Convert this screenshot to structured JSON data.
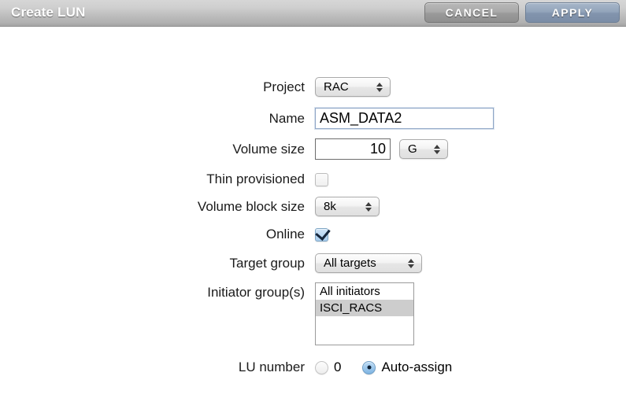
{
  "window": {
    "title": "Create LUN"
  },
  "titlebar": {
    "cancel_label": "CANCEL",
    "apply_label": "APPLY",
    "cancel_color": "#9a9a9a",
    "apply_color": "#8294ad",
    "title_color": "#ffffff"
  },
  "form": {
    "project": {
      "label": "Project",
      "value": "RAC"
    },
    "name": {
      "label": "Name",
      "value": "ASM_DATA2",
      "placeholder": "",
      "focused": true
    },
    "volume_size": {
      "label": "Volume size",
      "value": "10",
      "unit": "G"
    },
    "thin_provisioned": {
      "label": "Thin provisioned",
      "checked": false
    },
    "volume_block_size": {
      "label": "Volume block size",
      "value": "8k"
    },
    "online": {
      "label": "Online",
      "checked": true
    },
    "target_group": {
      "label": "Target group",
      "value": "All targets"
    },
    "initiator_groups": {
      "label": "Initiator group(s)",
      "options": [
        {
          "text": "All initiators",
          "selected": false
        },
        {
          "text": "ISCI_RACS",
          "selected": true
        }
      ],
      "selection_color": "#cdcdcd"
    },
    "lu_number": {
      "label": "LU number",
      "options": [
        {
          "text": "0",
          "selected": false
        },
        {
          "text": "Auto-assign",
          "selected": true
        }
      ],
      "selected_color": "#7fb4e2"
    }
  },
  "icons": {
    "stepper": "up-down-stepper-icon",
    "check": "checkmark-icon",
    "radio_dot": "radio-dot-icon"
  }
}
